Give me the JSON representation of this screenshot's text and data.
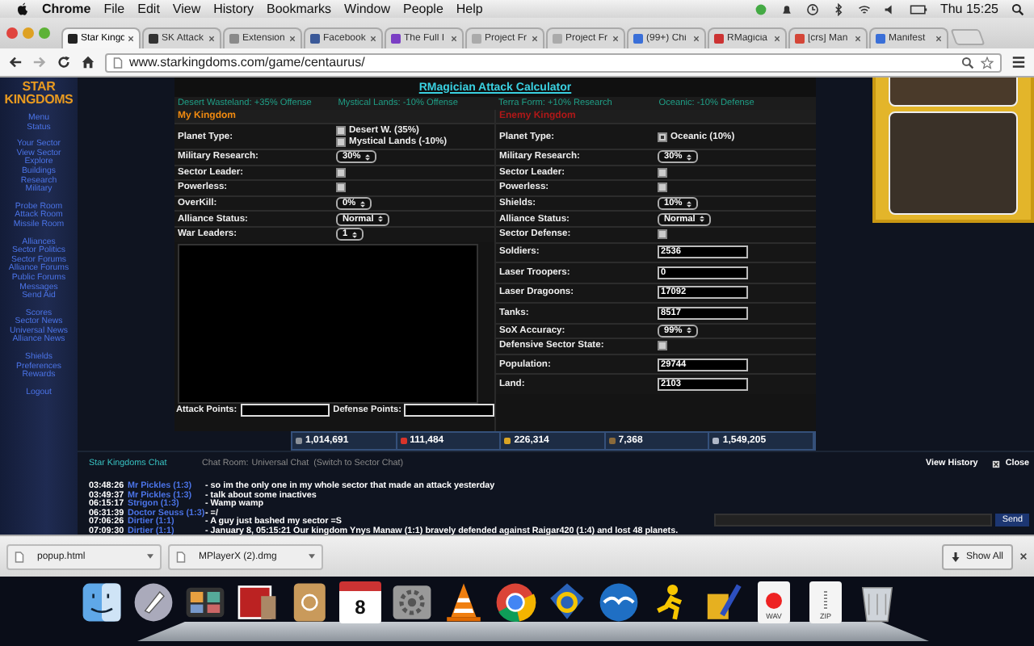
{
  "menubar": {
    "app": "Chrome",
    "menus": [
      "File",
      "Edit",
      "View",
      "History",
      "Bookmarks",
      "Window",
      "People",
      "Help"
    ],
    "clock": "Thu 15:25"
  },
  "tabs": [
    {
      "title": "Star Kingd",
      "selected": true,
      "color": "#222222"
    },
    {
      "title": "SK Attack",
      "selected": false,
      "color": "#333333"
    },
    {
      "title": "Extension",
      "selected": false,
      "color": "#8a8a8a"
    },
    {
      "title": "Facebook",
      "selected": false,
      "color": "#3b5998"
    },
    {
      "title": "The Full I",
      "selected": false,
      "color": "#7b3fc4"
    },
    {
      "title": "Project Fr",
      "selected": false,
      "color": "#aaaaaa"
    },
    {
      "title": "Project Fr",
      "selected": false,
      "color": "#aaaaaa"
    },
    {
      "title": "(99+) Chi",
      "selected": false,
      "color": "#3a6fd8"
    },
    {
      "title": "RMagicia",
      "selected": false,
      "color": "#cc3333"
    },
    {
      "title": "[crs] Man",
      "selected": false,
      "color": "#d44638"
    },
    {
      "title": "Manifest",
      "selected": false,
      "color": "#3a6fd8"
    }
  ],
  "address": "www.starkingdoms.com/game/centaurus/",
  "sidebar": {
    "logo": [
      "STAR",
      "KINGDOMS"
    ],
    "groups": [
      [
        "Menu",
        "Status"
      ],
      [
        "Your Sector",
        "View Sector",
        "Explore",
        "Buildings",
        "Research",
        "Military"
      ],
      [
        "Probe Room",
        "Attack Room",
        "Missile Room"
      ],
      [
        "Alliances",
        "Sector Politics",
        "Sector Forums",
        "Alliance Forums",
        "Public Forums",
        "Messages",
        "Send Aid"
      ],
      [
        "Scores",
        "Sector News",
        "Universal News",
        "Alliance News"
      ],
      [
        "Shields",
        "Preferences",
        "Rewards"
      ],
      [
        "Logout"
      ]
    ]
  },
  "calculator": {
    "title": "RMagician Attack Calculator",
    "bonuses": [
      "Desert Wasteland: +35% Offense",
      "Mystical Lands: -10% Offense",
      "Terra Form: +10% Research",
      "Oceanic: -10% Defense"
    ],
    "mine": {
      "heading": "My Kingdom",
      "rows": [
        {
          "kind": "planet",
          "label": "Planet Type:",
          "options": [
            {
              "text": "Desert W. (35%)",
              "checked": false
            },
            {
              "text": "Mystical Lands (-10%)",
              "checked": false
            }
          ]
        },
        {
          "kind": "select",
          "label": "Military Research:",
          "value": "30%"
        },
        {
          "kind": "checkbox",
          "label": "Sector Leader:",
          "checked": false
        },
        {
          "kind": "checkbox",
          "label": "Powerless:",
          "checked": false
        },
        {
          "kind": "select",
          "label": "OverKill:",
          "value": "0%"
        },
        {
          "kind": "select",
          "label": "Alliance Status:",
          "value": "Normal"
        },
        {
          "kind": "select",
          "label": "War Leaders:",
          "value": "1"
        }
      ],
      "points": [
        "Attack Points:",
        "Defense Points:"
      ]
    },
    "enemy": {
      "heading": "Enemy Kingdom",
      "rows": [
        {
          "kind": "planet",
          "label": "Planet Type:",
          "options": [
            {
              "text": "Oceanic (10%)",
              "checked": true
            }
          ]
        },
        {
          "kind": "select",
          "label": "Military Research:",
          "value": "30%"
        },
        {
          "kind": "checkbox",
          "label": "Sector Leader:",
          "checked": false
        },
        {
          "kind": "checkbox",
          "label": "Powerless:",
          "checked": false
        },
        {
          "kind": "select",
          "label": "Shields:",
          "value": "10%"
        },
        {
          "kind": "select",
          "label": "Alliance Status:",
          "value": "Normal"
        },
        {
          "kind": "checkbox",
          "label": "Sector Defense:",
          "checked": false
        },
        {
          "kind": "input",
          "label": "Soldiers:",
          "value": "2536"
        },
        {
          "kind": "input",
          "label": "Laser Troopers:",
          "value": "0"
        },
        {
          "kind": "input",
          "label": "Laser Dragoons:",
          "value": "17092"
        },
        {
          "kind": "input",
          "label": "Tanks:",
          "value": "8517"
        },
        {
          "kind": "select",
          "label": "SoX Accuracy:",
          "value": "99%"
        },
        {
          "kind": "checkbox",
          "label": "Defensive Sector State:",
          "checked": false
        },
        {
          "kind": "input",
          "label": "Population:",
          "value": "29744"
        },
        {
          "kind": "input",
          "label": "Land:",
          "value": "2103"
        }
      ]
    }
  },
  "stats": [
    {
      "value": "1,014,691",
      "color": "#8a9099"
    },
    {
      "value": "111,484",
      "color": "#d8342a"
    },
    {
      "value": "226,314",
      "color": "#d9a425"
    },
    {
      "value": "7,368",
      "color": "#8a6a3a"
    },
    {
      "value": "1,549,205",
      "color": "#b0b8c8"
    }
  ],
  "chat": {
    "title": "Star Kingdoms Chat",
    "room_label": "Chat Room:",
    "room": "Universal Chat",
    "switch": "(Switch to Sector Chat)",
    "history": "View History",
    "close": "Close",
    "send": "Send",
    "messages": [
      {
        "time": "03:48:26",
        "user": "Mr Pickles (1:3)",
        "text": "- so im the only one in my whole sector that made an attack yesterday"
      },
      {
        "time": "03:49:37",
        "user": "Mr Pickles (1:3)",
        "text": "- talk about some inactives"
      },
      {
        "time": "06:15:17",
        "user": "Strigon (1:3)",
        "text": "- Wamp wamp"
      },
      {
        "time": "06:31:39",
        "user": "Doctor Seuss (1:3)",
        "text": "- =/"
      },
      {
        "time": "07:06:26",
        "user": "Dirtier (1:1)",
        "text": "- A guy just bashed my sector =S"
      },
      {
        "time": "07:09:30",
        "user": "Dirtier (1:1)",
        "text": "- January 8, 05:15:21 Our kingdom Ynys Manaw (1:1) bravely defended against Raigar420 (1:4) and lost 48 planets."
      }
    ]
  },
  "downloads": {
    "files": [
      "popup.html",
      "MPlayerX (2).dmg"
    ],
    "show_all": "Show All"
  },
  "dock": {
    "calendar_day": "8",
    "files": [
      "WAV",
      "ZIP"
    ]
  }
}
